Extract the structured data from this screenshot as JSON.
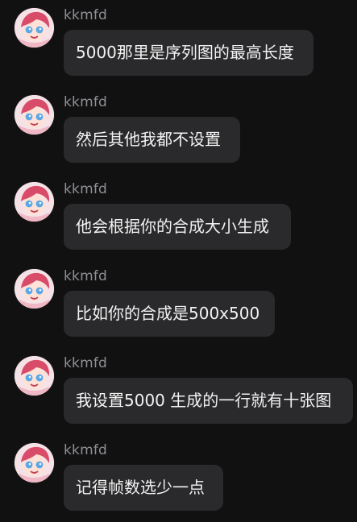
{
  "messages": [
    {
      "username": "kkmfd",
      "text": "5000那里是序列图的最高长度"
    },
    {
      "username": "kkmfd",
      "text": "然后其他我都不设置"
    },
    {
      "username": "kkmfd",
      "text": "他会根据你的合成大小生成"
    },
    {
      "username": "kkmfd",
      "text": "比如你的合成是500x500"
    },
    {
      "username": "kkmfd",
      "text": "我设置5000 生成的一行就有十张图"
    },
    {
      "username": "kkmfd",
      "text": "记得帧数选少一点"
    }
  ],
  "avatar_icon": "anime-girl-avatar-icon",
  "colors": {
    "background": "#111112",
    "bubble": "#2a2a2c",
    "username": "#8f8f95",
    "text": "#f2f2f2",
    "avatar_background": "#f3d7dc"
  }
}
